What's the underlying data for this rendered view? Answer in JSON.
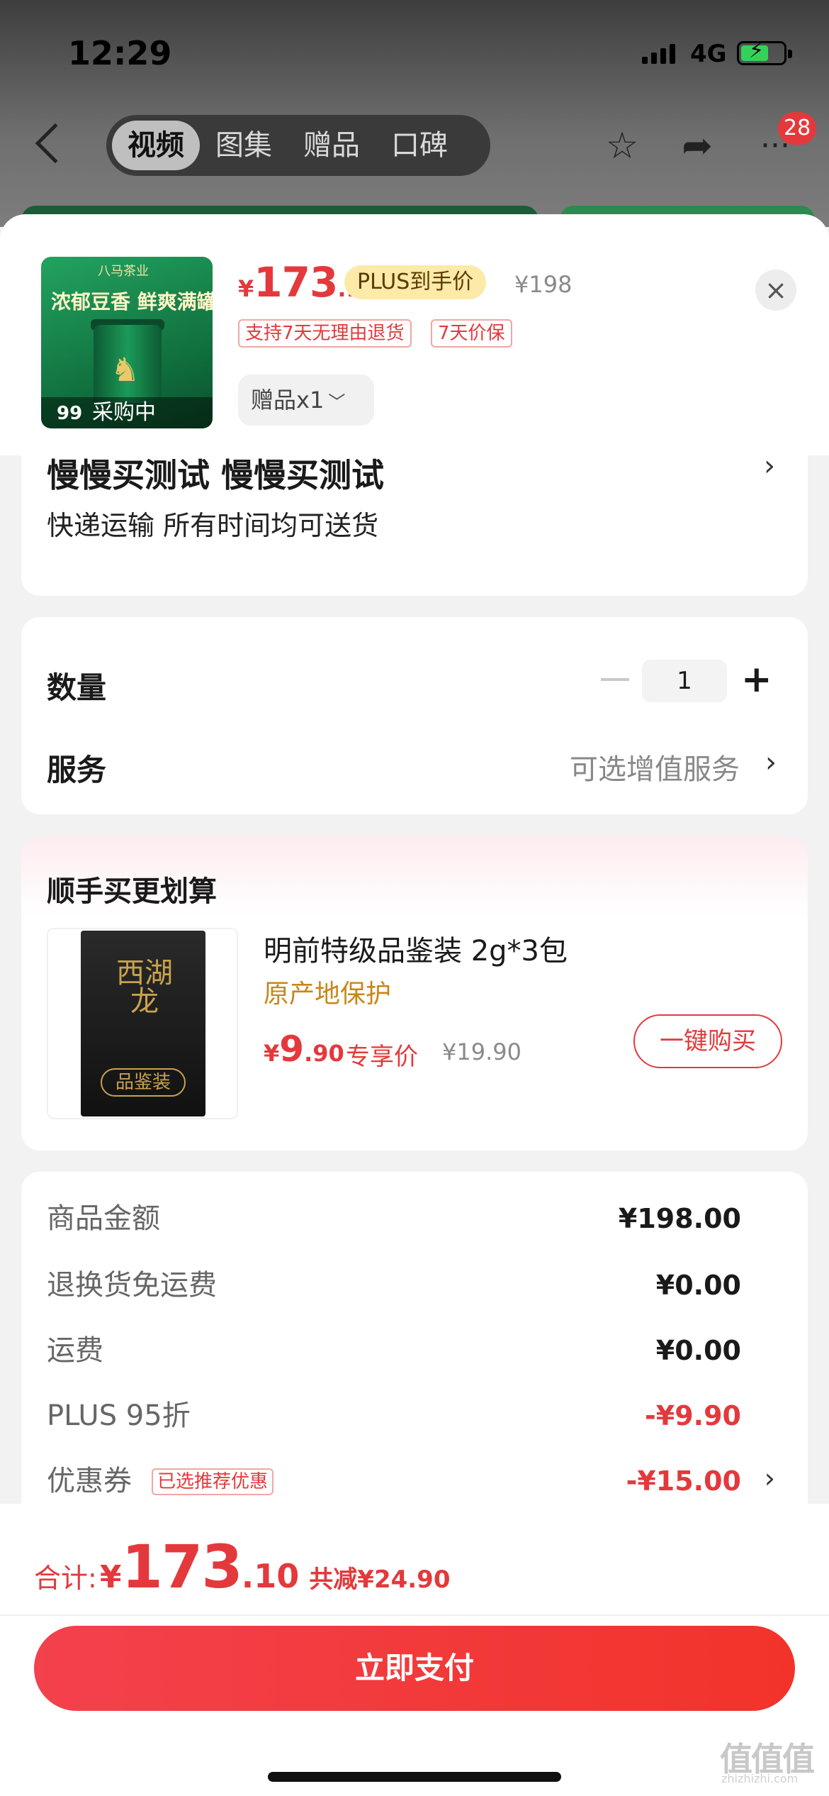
{
  "status_bar": {
    "time": "12:29",
    "network": "4G"
  },
  "nav": {
    "tabs": [
      "视频",
      "图集",
      "赠品",
      "口碑"
    ],
    "badge": "28",
    "icons": [
      "chevron-left-icon",
      "star-icon",
      "share-icon",
      "more-icon"
    ]
  },
  "product": {
    "thumb_brand": "八马茶业",
    "thumb_slogan": "浓郁豆香 鲜爽满罐",
    "thumb_badge": "99",
    "thumb_status": "采购中",
    "price_yen": "¥",
    "price_int": "173",
    "price_dec": ".1",
    "plus_tag": "PLUS到手价",
    "original_price": "¥198",
    "service_tags": [
      "支持7天无理由退货",
      "7天价保"
    ],
    "gift": "赠品x1"
  },
  "address": {
    "title": "慢慢买测试  慢慢买测试",
    "subtitle": "快递运输 所有时间均可送货"
  },
  "options": {
    "quantity_label": "数量",
    "quantity_value": "1",
    "service_label": "服务",
    "service_value": "可选增值服务"
  },
  "addon": {
    "title": "顺手买更划算",
    "image_text": "西湖龙",
    "image_label": "品鉴装",
    "name": "明前特级品鉴装 2g*3包",
    "origin": "原产地保护",
    "price_yen": "¥",
    "price_int": "9",
    "price_dec": ".90",
    "price_tag": "专享价",
    "original_price": "¥19.90",
    "buy_button": "一键购买"
  },
  "fees": [
    {
      "label": "商品金额",
      "value": "¥198.00",
      "red": false
    },
    {
      "label": "退换货免运费",
      "value": "¥0.00",
      "red": false
    },
    {
      "label": "运费",
      "value": "¥0.00",
      "red": false
    },
    {
      "label": "PLUS 95折",
      "value": "-¥9.90",
      "red": true
    },
    {
      "label": "优惠券",
      "value": "-¥15.00",
      "red": true
    }
  ],
  "coupon_tag": "已选推荐优惠",
  "bottom": {
    "total_label": "合计:",
    "total_yen": "¥",
    "total_int": "173",
    "total_dec": ".10",
    "total_saved": "共减¥24.90",
    "pay_button": "立即支付"
  },
  "watermark": {
    "mark": "值值值",
    "sub": "zhizhizhi.com"
  },
  "colors": {
    "accent": "#e4393c",
    "plus_tag_bg": "#fde9a8",
    "origin": "#c8861a"
  }
}
